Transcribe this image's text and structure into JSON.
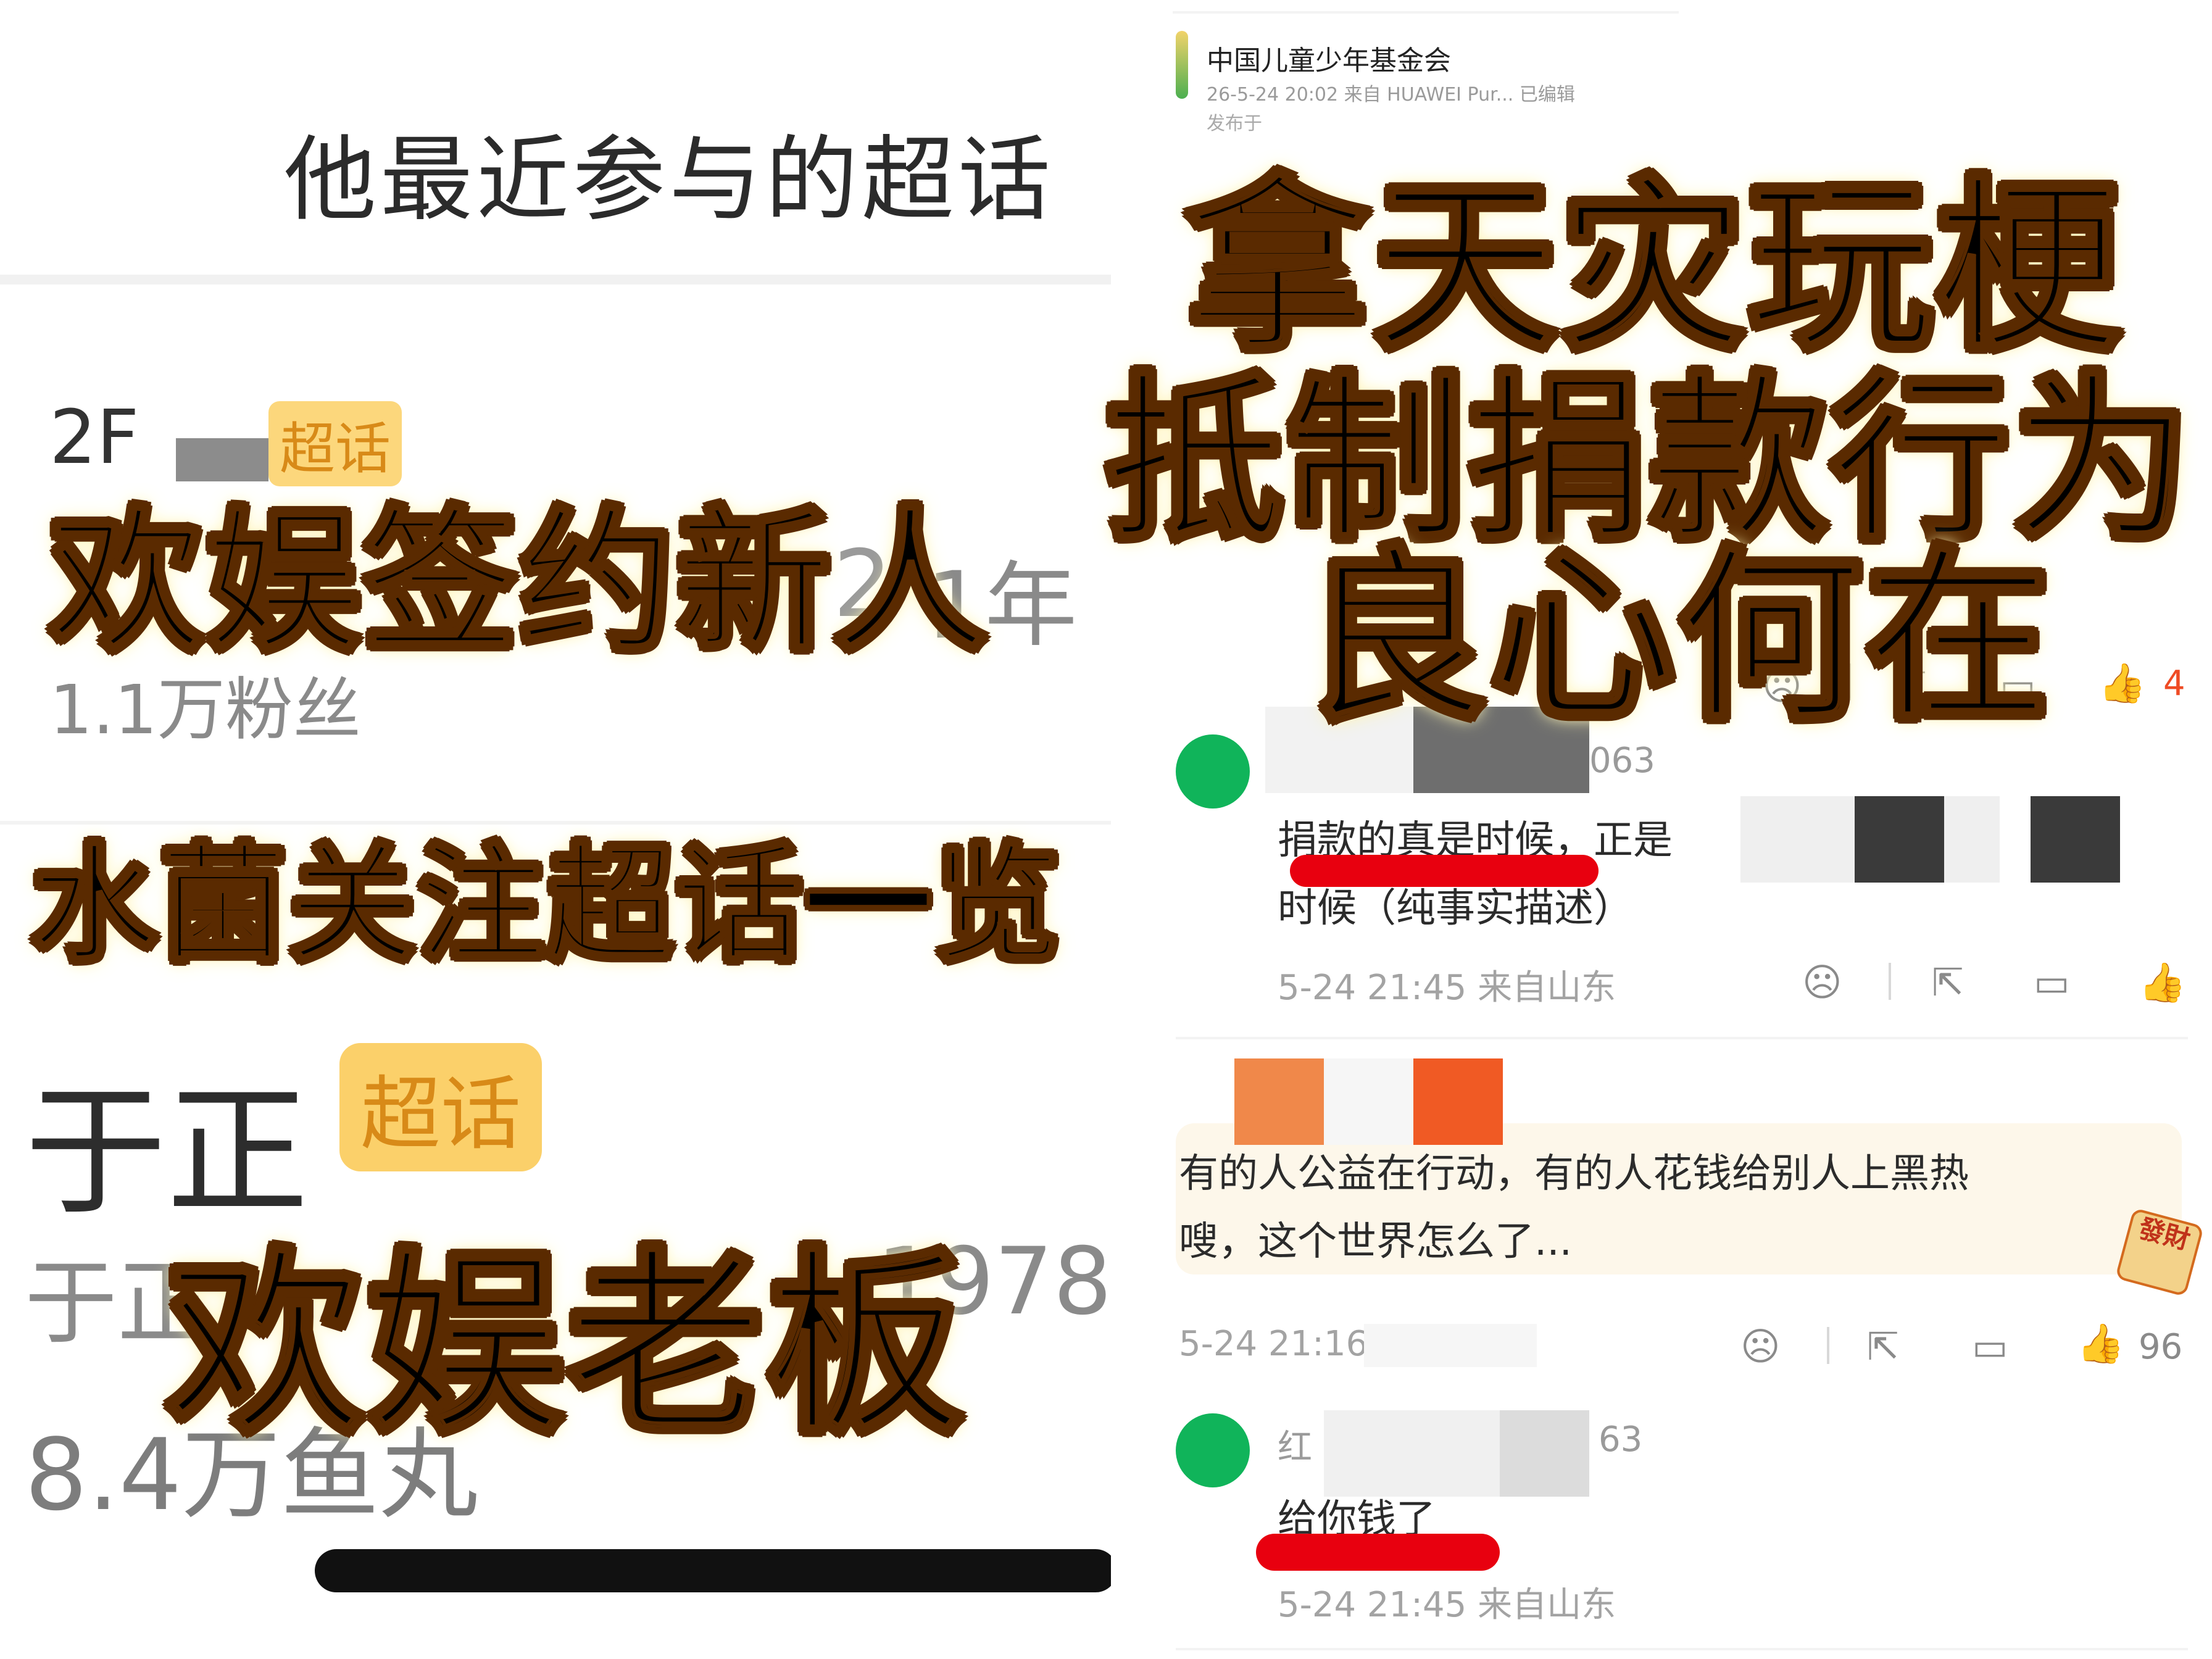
{
  "left": {
    "section_title": "他最近参与的超话",
    "topic1": {
      "name_fragment": "2F",
      "badge": "超话",
      "desc_fragment": "2",
      "desc_tail": "1年",
      "fans": "1.1万粉丝"
    },
    "topic2": {
      "name": "于正",
      "badge": "超话",
      "desc_fragment": "于正",
      "desc_tail": "1978",
      "fans": "8.4万鱼丸"
    }
  },
  "right": {
    "post": {
      "author": "中国儿童少年基金会",
      "meta": "26-5-24 20:02  来自 HUAWEI Pur...  已编辑",
      "pub": "发布于",
      "like_count": "4"
    },
    "comment1": {
      "user_tail": "063",
      "line1_a": "捐款的真是时候，正是",
      "line2": "时候（纯事实描述）",
      "meta": "5-24 21:45  来自山东"
    },
    "comment2": {
      "line1": "有的人公益在行动，有的人花钱给别人上黑热",
      "line2": "嗖，这个世界怎么了...",
      "meta": "5-24 21:16",
      "like_count": "96",
      "sticker": "發財"
    },
    "comment3": {
      "user_head": "红",
      "user_tail": "63",
      "text": "给你钱了",
      "meta": "5-24 21:45  来自山东"
    }
  },
  "captions": {
    "left_top": "欢娱签约新人",
    "left_mid": "水菌关注超话一览",
    "left_bottom": "欢娱老板",
    "right_line1": "拿天灾玩梗",
    "right_line2": "抵制捐款行为",
    "right_line3": "良心何在"
  },
  "colors": {
    "caption_fill": "#fbb51b",
    "caption_outline": "#5a2a00",
    "badge_bg": "#fbd06a",
    "avatar_green": "#10b45a",
    "underline_red": "#e8000f",
    "like_red": "#ef4b24"
  },
  "icons": [
    "dislike-icon",
    "share-icon",
    "comment-icon",
    "like-icon"
  ]
}
